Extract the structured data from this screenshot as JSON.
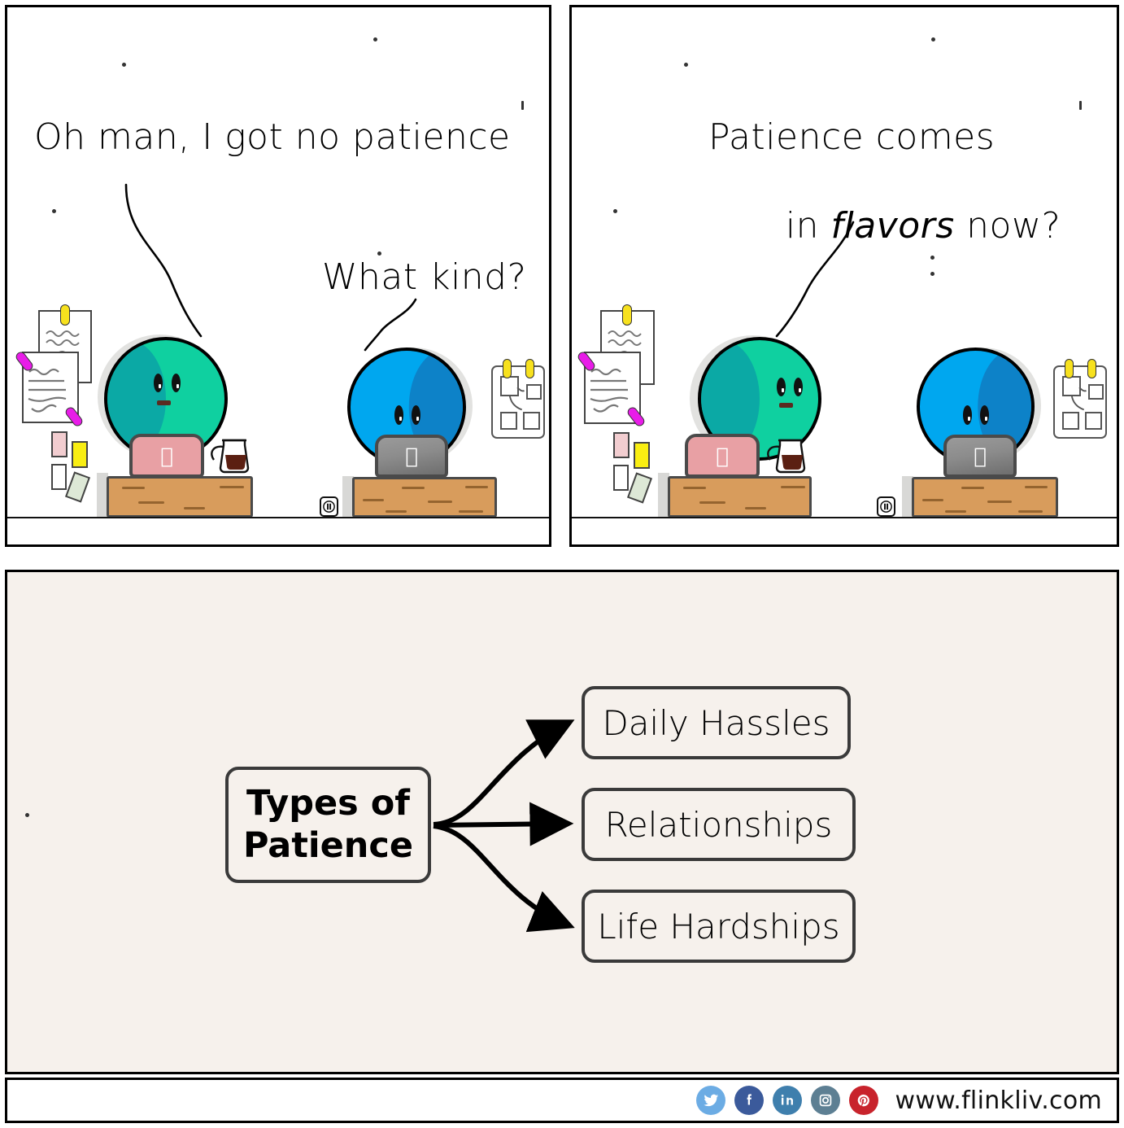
{
  "comic": {
    "site_url": "www.flinkliv.com",
    "panels": [
      {
        "id": "panel-1",
        "lines": [
          {
            "name": "line-green-p1",
            "text": "Oh man, I got no patience"
          },
          {
            "name": "line-blue-p1",
            "text": "What kind?"
          }
        ],
        "characters": [
          {
            "name": "green-character",
            "color": "#0fd0a0",
            "shade": "#0ba9a5"
          },
          {
            "name": "blue-character",
            "color": "#00a7ef",
            "shade": "#0d82c8"
          }
        ]
      },
      {
        "id": "panel-2",
        "lines": [
          {
            "name": "line-green-p2-a",
            "text": "Patience comes"
          },
          {
            "name": "line-green-p2-b-pre",
            "text": "in "
          },
          {
            "name": "line-green-p2-b-em",
            "text": "flavors"
          },
          {
            "name": "line-green-p2-b-post",
            "text": " now?"
          }
        ],
        "characters": [
          {
            "name": "green-character",
            "color": "#0fd0a0",
            "shade": "#0ba9a5"
          },
          {
            "name": "blue-character",
            "color": "#00a7ef",
            "shade": "#0d82c8"
          }
        ]
      }
    ]
  },
  "diagram": {
    "background": "#f6f1ec",
    "root": {
      "label": "Types of\nPatience"
    },
    "branches": [
      {
        "label": "Daily Hassles"
      },
      {
        "label": "Relationships"
      },
      {
        "label": "Life Hardships"
      }
    ]
  },
  "chart_data": {
    "type": "diagram",
    "title": "Types of Patience",
    "nodes": [
      "Types of Patience",
      "Daily Hassles",
      "Relationships",
      "Life Hardships"
    ],
    "edges": [
      [
        "Types of Patience",
        "Daily Hassles"
      ],
      [
        "Types of Patience",
        "Relationships"
      ],
      [
        "Types of Patience",
        "Life Hardships"
      ]
    ]
  },
  "footer": {
    "url": "www.flinkliv.com",
    "social": [
      {
        "name": "twitter-icon",
        "glyph": "ᴠ",
        "color": "#6cace4"
      },
      {
        "name": "facebook-icon",
        "glyph": "f",
        "color": "#3b5a9b"
      },
      {
        "name": "linkedin-icon",
        "glyph": "in",
        "color": "#3f7fad"
      },
      {
        "name": "instagram-icon",
        "glyph": "□",
        "color": "#5d7f93"
      },
      {
        "name": "pinterest-icon",
        "glyph": "P",
        "color": "#c8232c"
      }
    ]
  }
}
